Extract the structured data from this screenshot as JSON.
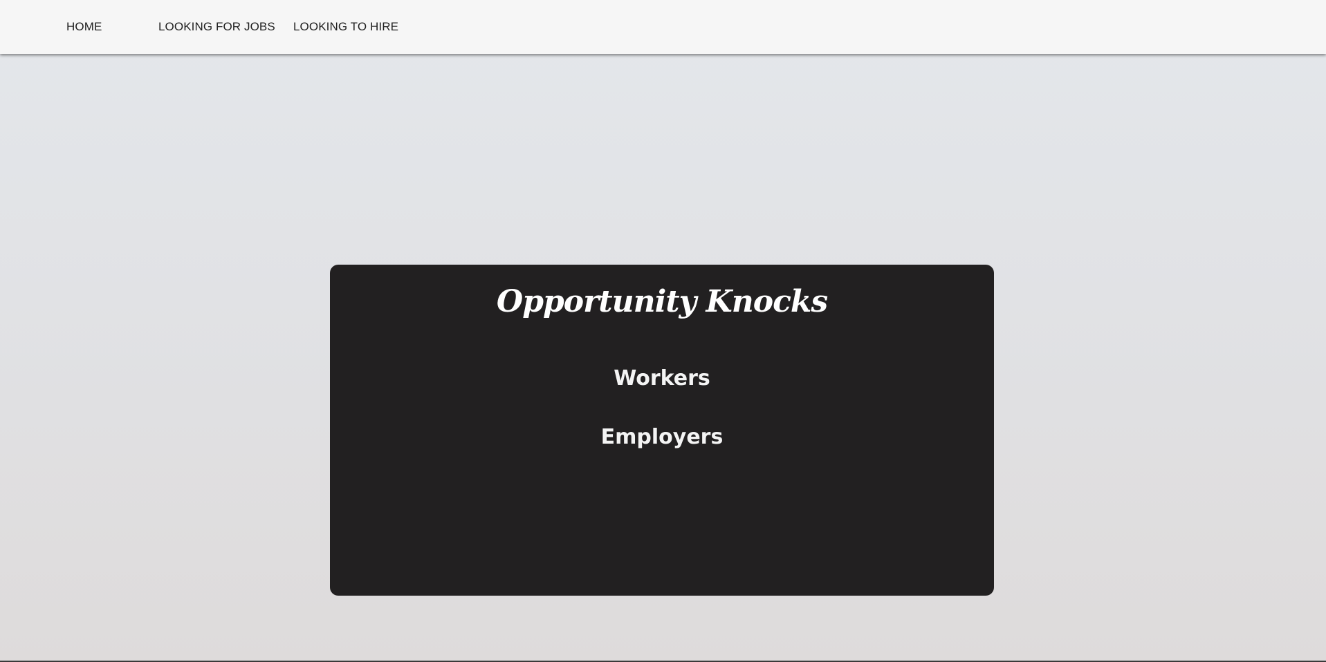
{
  "nav": {
    "items": [
      {
        "label": "HOME"
      },
      {
        "label": "LOOKING FOR JOBS"
      },
      {
        "label": "LOOKING TO HIRE"
      }
    ]
  },
  "hero": {
    "title": "Opportunity Knocks",
    "links": [
      {
        "label": "Workers"
      },
      {
        "label": "Employers"
      }
    ]
  },
  "colors": {
    "navbar_bg": "#f6f6f6",
    "card_bg": "#222021",
    "card_text": "#ffffff",
    "nav_text": "#1f1f1f"
  }
}
